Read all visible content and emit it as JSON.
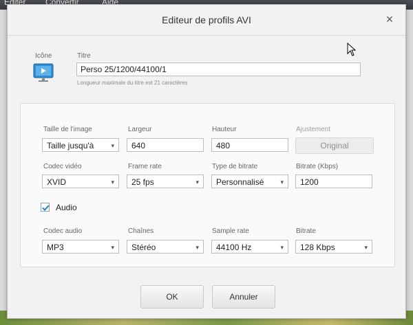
{
  "background": {
    "menu": [
      "Editer",
      "Convertir",
      "Aide"
    ]
  },
  "dialog": {
    "title": "Editeur de profils AVI",
    "close_glyph": "×",
    "icon_label": "Icône",
    "title_label": "Titre",
    "title_value": "Perso 25/1200/44100/1",
    "title_hint": "Longueur maximale du titre est 21 caractères",
    "video": {
      "image_size_label": "Taille de l'image",
      "image_size_value": "Taille jusqu'à",
      "width_label": "Largeur",
      "width_value": "640",
      "height_label": "Hauteur",
      "height_value": "480",
      "adjust_label": "Ajustement",
      "adjust_value": "Original",
      "codec_label": "Codec vidéo",
      "codec_value": "XVID",
      "framerate_label": "Frame rate",
      "framerate_value": "25 fps",
      "bitrate_type_label": "Type de bitrate",
      "bitrate_type_value": "Personnalisé",
      "bitrate_label": "Bitrate (Kbps)",
      "bitrate_value": "1200"
    },
    "audio": {
      "checkbox_label": "Audio",
      "checked": true,
      "codec_label": "Codec audio",
      "codec_value": "MP3",
      "channels_label": "Chaînes",
      "channels_value": "Stéréo",
      "samplerate_label": "Sample rate",
      "samplerate_value": "44100 Hz",
      "bitrate_label": "Bitrate",
      "bitrate_value": "128 Kbps"
    },
    "ok_label": "OK",
    "cancel_label": "Annuler"
  },
  "icons": [
    "close-icon",
    "video-profile-icon",
    "dropdown-arrow-icon",
    "checkmark-icon",
    "mouse-cursor-icon"
  ],
  "colors": {
    "accent": "#2f8fd6",
    "checkmark": "#2c7fbf"
  }
}
